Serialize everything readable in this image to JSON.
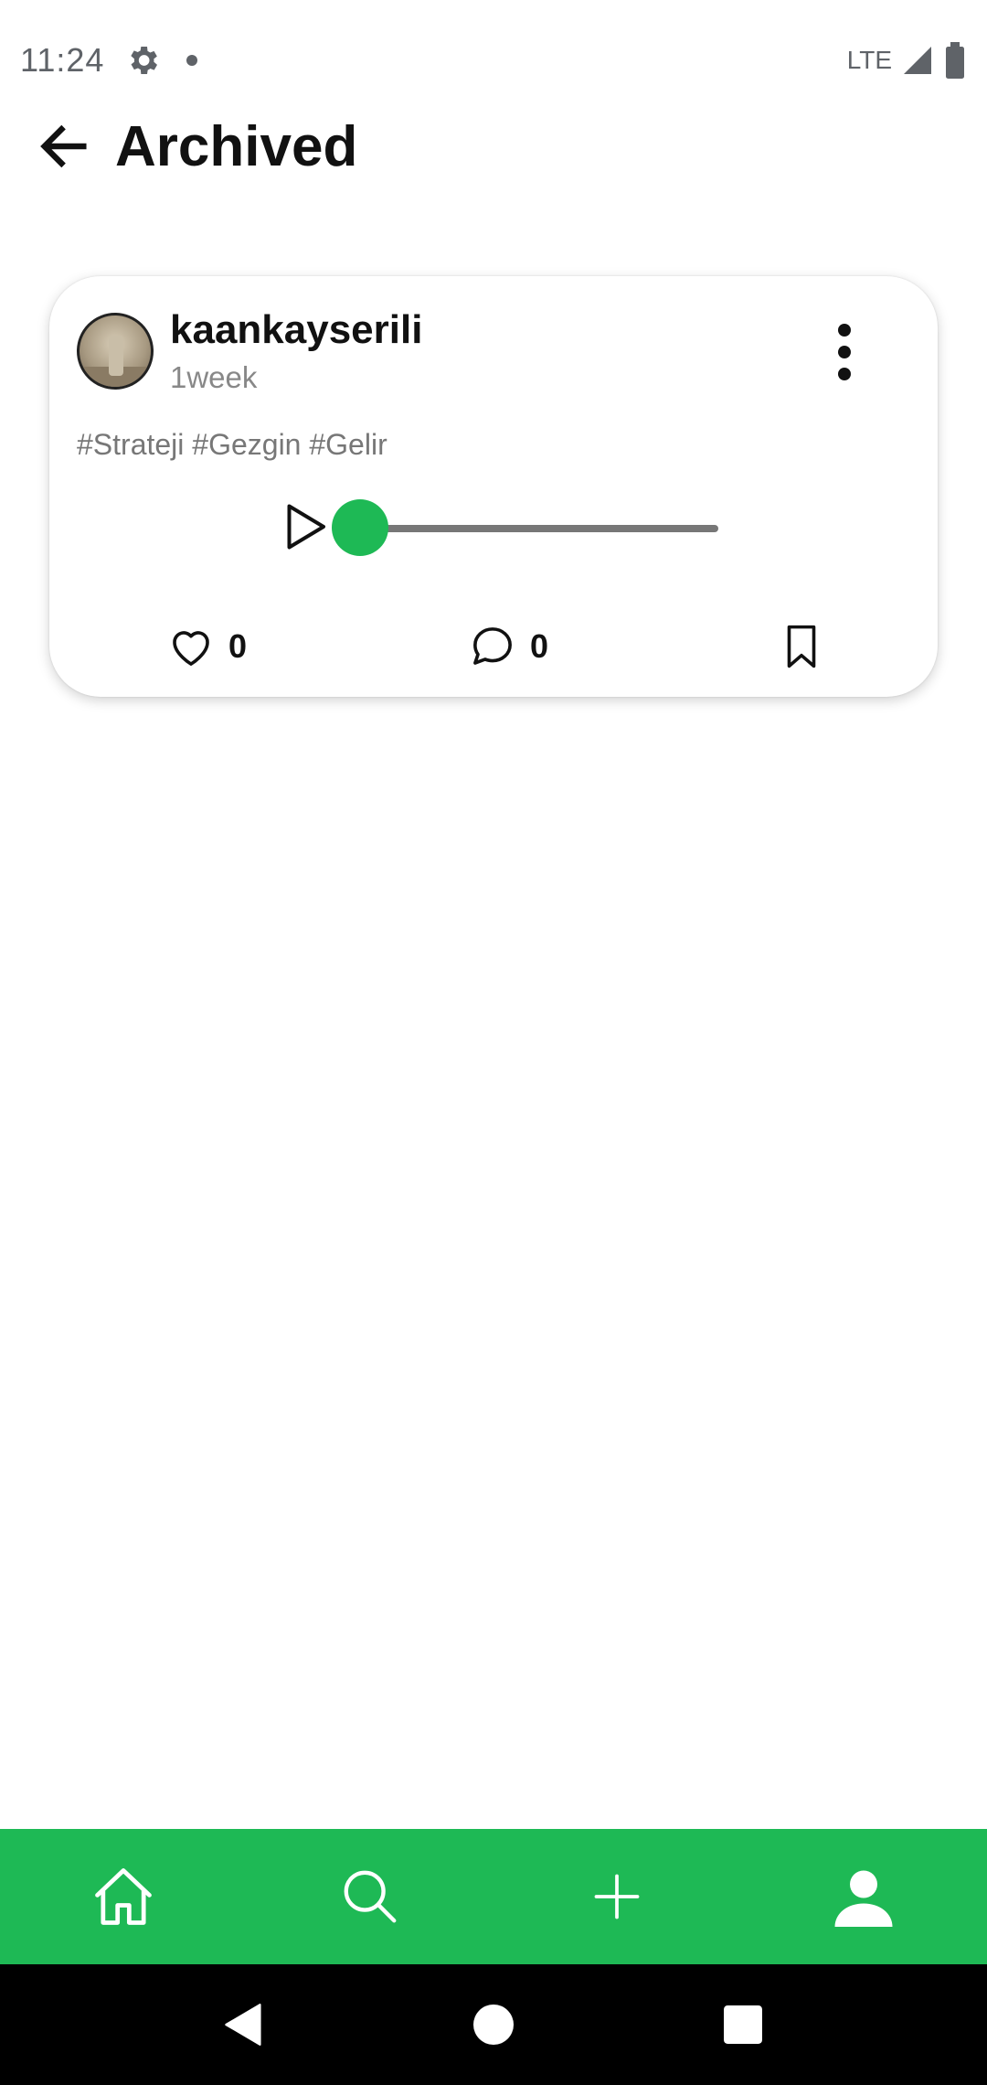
{
  "status_bar": {
    "time": "11:24",
    "network": "LTE"
  },
  "app_bar": {
    "title": "Archived"
  },
  "post": {
    "username": "kaankayserili",
    "time_ago": "1week",
    "tags": "#Strateji #Gezgin #Gelir",
    "audio_progress": 0,
    "likes_count": "0",
    "comments_count": "0"
  },
  "icons": {
    "back": "arrow-left-icon",
    "more": "more-vertical-icon",
    "play": "play-icon",
    "like": "heart-icon",
    "comment": "comment-icon",
    "bookmark": "bookmark-icon",
    "home": "home-icon",
    "search": "search-icon",
    "add": "plus-icon",
    "profile": "person-icon"
  },
  "colors": {
    "accent": "#1eb955",
    "text": "#111111",
    "muted": "#888888"
  }
}
